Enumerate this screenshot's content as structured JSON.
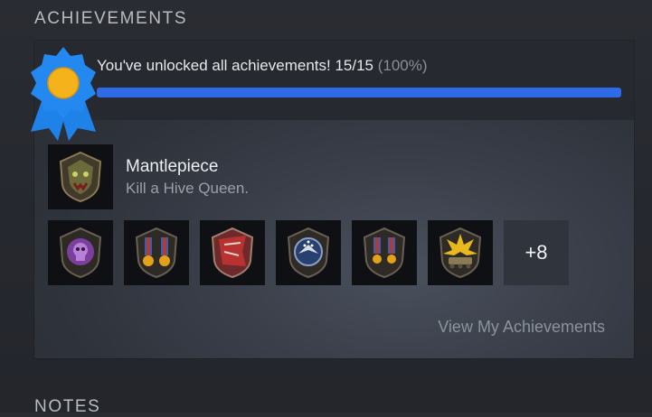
{
  "sections": {
    "achievements_title": "ACHIEVEMENTS",
    "notes_title": "NOTES"
  },
  "summary": {
    "text": "You've unlocked all achievements! 15/15",
    "percent_text": "(100%)",
    "progress": 1.0,
    "progress_color": "#2f6be8"
  },
  "recent": {
    "name": "Mantlepiece",
    "description": "Kill a Hive Queen.",
    "icon": "bug-emblem-icon"
  },
  "icons": [
    {
      "name": "purple-skull-gear-icon"
    },
    {
      "name": "two-star-medal-icon"
    },
    {
      "name": "red-flag-icon"
    },
    {
      "name": "eagle-emblem-icon"
    },
    {
      "name": "two-star-medal-bronze-icon"
    },
    {
      "name": "explosion-tank-icon"
    }
  ],
  "more_count": "+8",
  "view_link": "View My Achievements",
  "colors": {
    "accent": "#2f6be8",
    "award_blue": "#1e82e8",
    "award_gold": "#f5b21b"
  }
}
